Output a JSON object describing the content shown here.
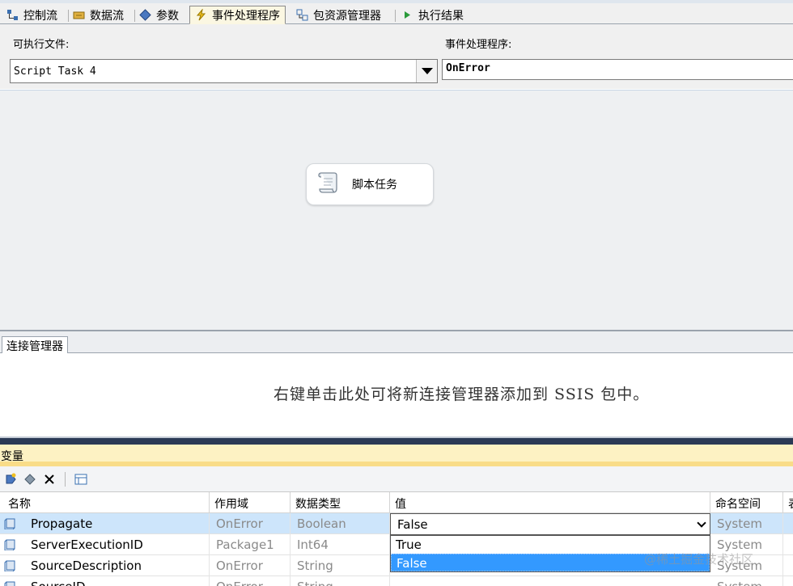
{
  "tabs": [
    {
      "label": "控制流",
      "icon": "control-flow-icon"
    },
    {
      "label": "数据流",
      "icon": "data-flow-icon"
    },
    {
      "label": "参数",
      "icon": "parameters-icon"
    },
    {
      "label": "事件处理程序",
      "icon": "lightning-icon",
      "active": true
    },
    {
      "label": "包资源管理器",
      "icon": "package-explorer-icon"
    },
    {
      "label": "执行结果",
      "icon": "play-arrow-icon"
    }
  ],
  "selector": {
    "executable_label": "可执行文件:",
    "executable_value": "Script Task 4",
    "event_handler_label": "事件处理程序:",
    "event_handler_value": "OnError"
  },
  "design_surface": {
    "task_label": "脚本任务",
    "task_icon": "script-scroll-icon"
  },
  "connection_managers": {
    "tab_label": "连接管理器",
    "hint": "右键单击此处可将新连接管理器添加到 SSIS 包中。"
  },
  "variables": {
    "title": "变量",
    "toolbar": [
      "add-variable-icon",
      "move-variable-icon",
      "delete-icon",
      "grid-options-icon"
    ],
    "columns": [
      "名称",
      "作用域",
      "数据类型",
      "值",
      "命名空间",
      "表"
    ],
    "rows": [
      {
        "name": "Propagate",
        "scope": "OnError",
        "type": "Boolean",
        "value": "False",
        "namespace": "System"
      },
      {
        "name": "ServerExecutionID",
        "scope": "Package1",
        "type": "Int64",
        "value": "",
        "namespace": "System"
      },
      {
        "name": "SourceDescription",
        "scope": "OnError",
        "type": "String",
        "value": "",
        "namespace": "System"
      },
      {
        "name": "SourceID",
        "scope": "OnError",
        "type": "String",
        "value": "",
        "namespace": "System"
      }
    ],
    "dropdown": {
      "value": "False",
      "options": [
        "True",
        "False"
      ]
    }
  },
  "watermark": "@稀土掘金技术社区",
  "colors": {
    "active_tab": "#fbf7e2",
    "selected_row": "#cde5fb",
    "highlight": "#3399ff",
    "title_bar": "#fdf2c3",
    "divider": "#2b3a55"
  }
}
